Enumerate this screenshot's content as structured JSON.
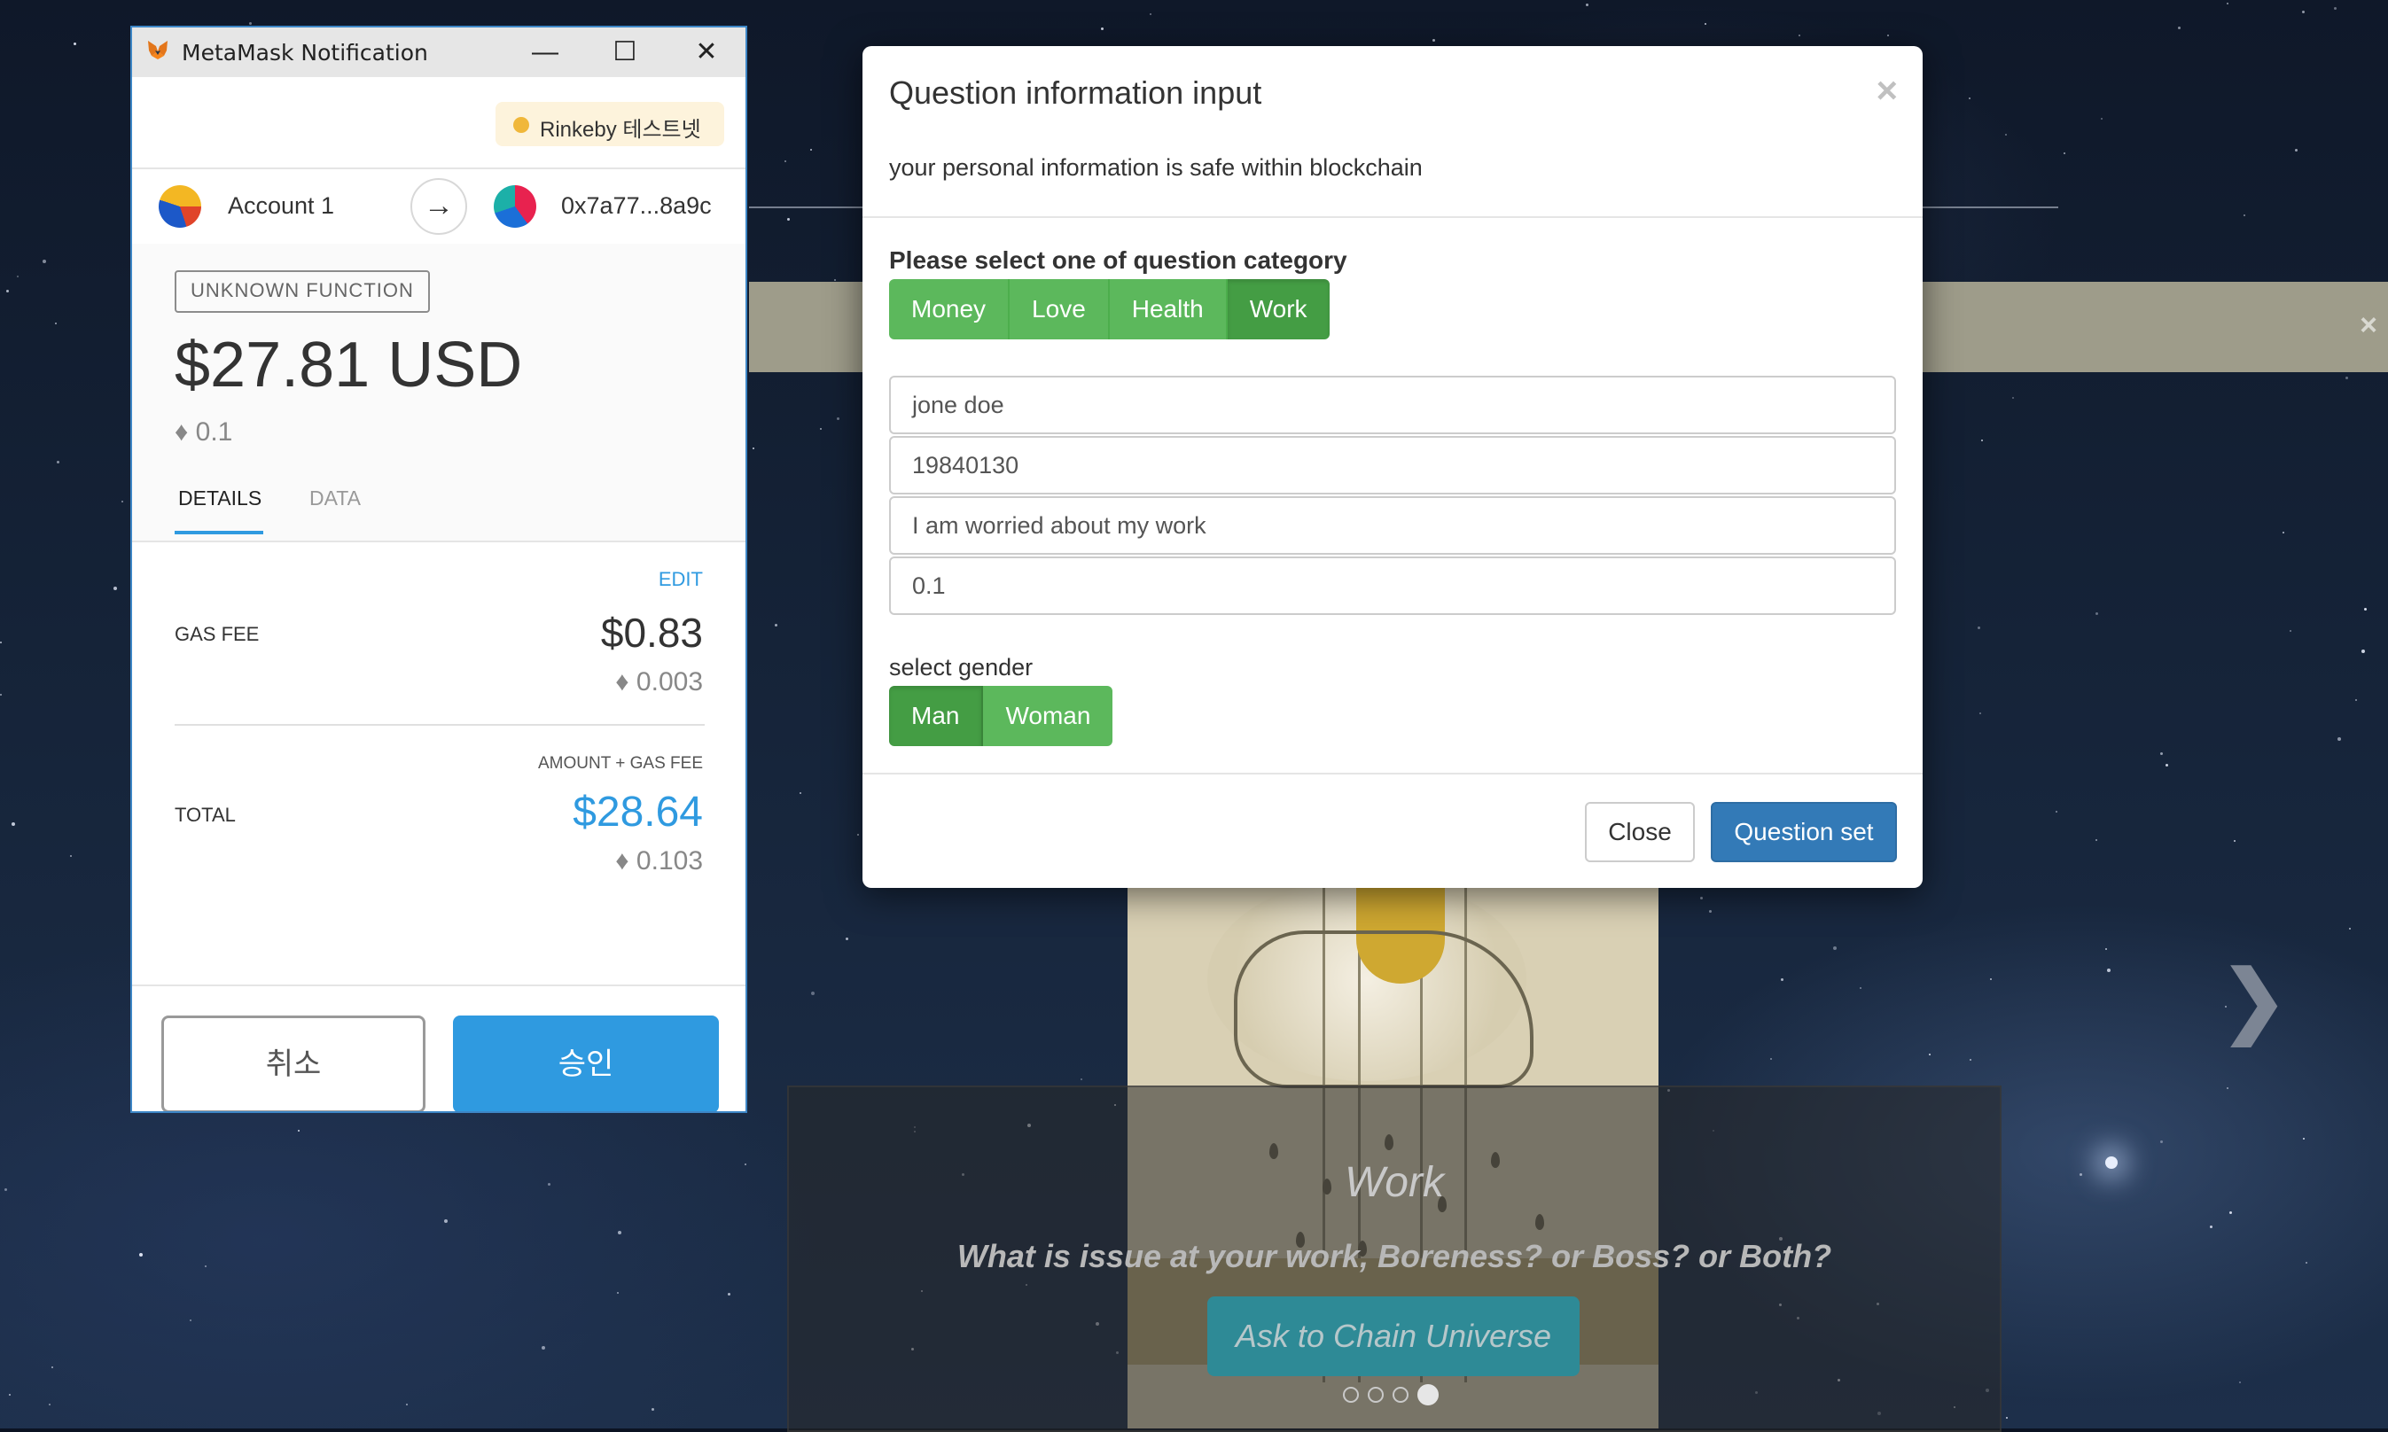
{
  "metamask": {
    "window_title": "MetaMask Notification",
    "window_buttons": {
      "minimize": "—",
      "maximize": "☐",
      "close": "✕"
    },
    "network": "Rinkeby 테스트넷",
    "network_color": "#f0b73a",
    "from_account": "Account 1",
    "to_address": "0x7a77...8a9c",
    "transfer_arrow": "→",
    "function_badge": "UNKNOWN FUNCTION",
    "amount_usd": "$27.81 USD",
    "amount_eth": "♦ 0.1",
    "tabs": {
      "details": "DETAILS",
      "data": "DATA",
      "active": "details"
    },
    "edit_label": "EDIT",
    "gas_fee_label": "GAS FEE",
    "gas_fee_usd": "$0.83",
    "gas_fee_eth": "♦ 0.003",
    "amount_plus_gas_label": "AMOUNT + GAS FEE",
    "total_label": "TOTAL",
    "total_usd": "$28.64",
    "total_eth": "♦ 0.103",
    "cancel_label": "취소",
    "confirm_label": "승인",
    "accent_color": "#2f9ae0"
  },
  "modal": {
    "title": "Question information input",
    "close_x": "×",
    "subtitle": "your personal information is safe within blockchain",
    "category_label": "Please select one of question category",
    "categories": [
      "Money",
      "Love",
      "Health",
      "Work"
    ],
    "selected_category": "Work",
    "fields": {
      "name": "jone doe",
      "birthdate": "19840130",
      "question": "I am worried about my work",
      "amount": "0.1"
    },
    "gender_label": "select gender",
    "genders": [
      "Man",
      "Woman"
    ],
    "selected_gender": "Man",
    "close_button": "Close",
    "submit_button": "Question set",
    "success_color": "#5cb85c",
    "primary_color": "#337ab7"
  },
  "background": {
    "alert_close": "×",
    "next_arrow": "❯",
    "slide_title": "Work",
    "slide_description": "What is issue at your work, Boreness? or Boss? or Both?",
    "slide_button": "Ask to Chain Universe",
    "slide_count": 4,
    "active_slide": 4
  }
}
